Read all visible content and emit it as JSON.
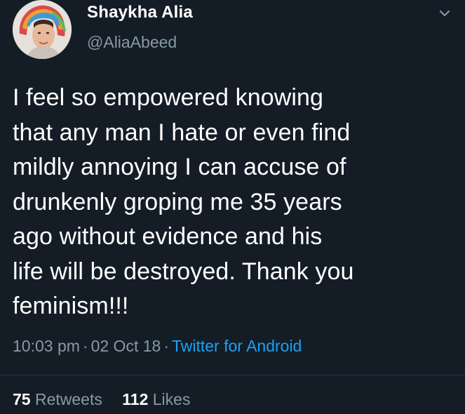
{
  "author": {
    "display_name": "Shaykha Alia",
    "handle": "@AliaAbeed",
    "avatar": "profile-photo"
  },
  "tweet": {
    "text": "I feel so empowered knowing\nthat any man I hate or even find\nmildly annoying I can accuse of\ndrunkenly groping me 35 years\nago without evidence and his\nlife will be destroyed. Thank you\nfeminism!!!"
  },
  "meta": {
    "time": "10:03 pm",
    "separator": "·",
    "date": "02 Oct 18",
    "source": "Twitter for Android"
  },
  "stats": {
    "retweets_count": "75",
    "retweets_label": "Retweets",
    "likes_count": "112",
    "likes_label": "Likes"
  },
  "colors": {
    "background": "#141d26",
    "primary_text": "#ffffff",
    "secondary_text": "#8899a6",
    "link": "#1da1f2"
  },
  "icons": {
    "menu": "chevron-down-icon"
  }
}
